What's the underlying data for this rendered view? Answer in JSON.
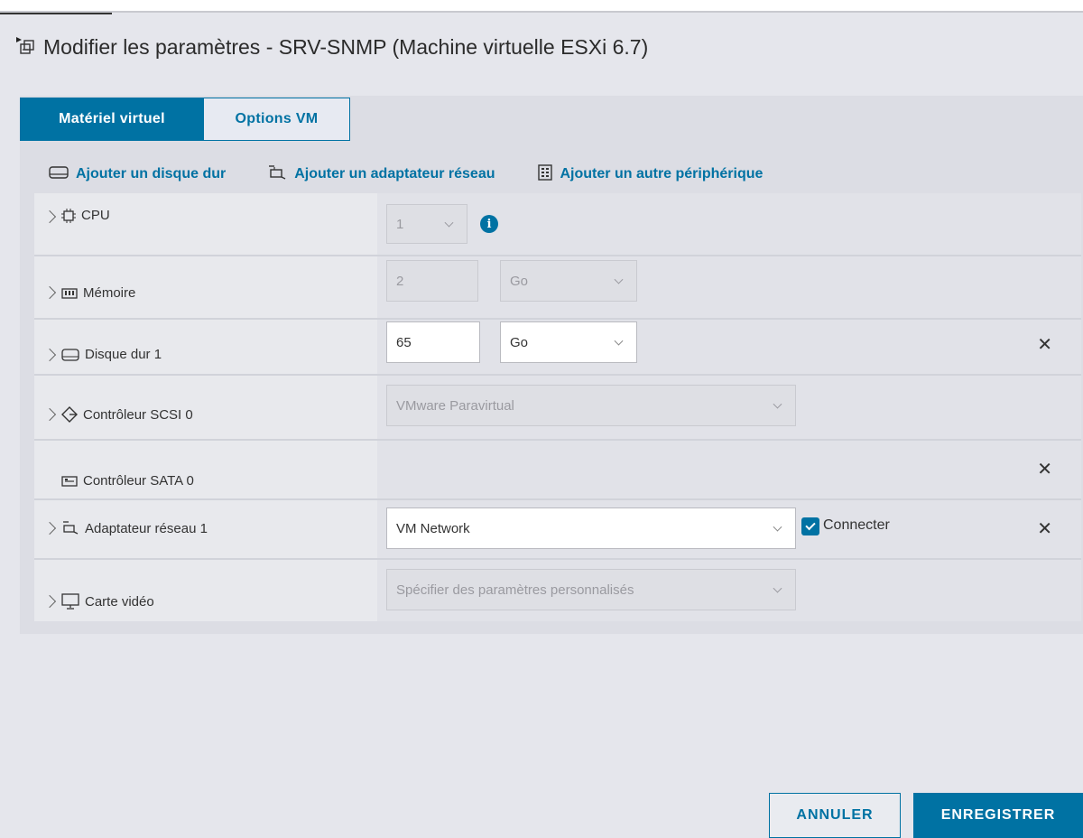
{
  "dialog": {
    "title": "Modifier les paramètres - SRV-SNMP (Machine virtuelle ESXi 6.7)"
  },
  "tabs": [
    {
      "label": "Matériel virtuel",
      "active": true
    },
    {
      "label": "Options VM",
      "active": false
    }
  ],
  "actions": [
    {
      "label": "Ajouter un disque dur",
      "icon": "hard-disk-icon"
    },
    {
      "label": "Ajouter un adaptateur réseau",
      "icon": "network-adapter-icon"
    },
    {
      "label": "Ajouter un autre périphérique",
      "icon": "device-icon"
    }
  ],
  "hardware": {
    "cpu": {
      "label": "CPU",
      "value": "1"
    },
    "memory": {
      "label": "Mémoire",
      "value": "2",
      "unit": "Go"
    },
    "disk": {
      "label": "Disque dur 1",
      "value": "65",
      "unit": "Go"
    },
    "scsi": {
      "label": "Contrôleur SCSI 0",
      "value": "VMware Paravirtual"
    },
    "sata": {
      "label": "Contrôleur SATA 0"
    },
    "network": {
      "label": "Adaptateur réseau 1",
      "value": "VM Network",
      "connect_label": "Connecter",
      "connected": true
    },
    "video": {
      "label": "Carte vidéo",
      "value": "Spécifier des paramètres personnalisés"
    }
  },
  "buttons": {
    "cancel": "ANNULER",
    "save": "ENREGISTRER"
  },
  "colors": {
    "accent": "#0072a3",
    "background": "#e5e6ec"
  }
}
